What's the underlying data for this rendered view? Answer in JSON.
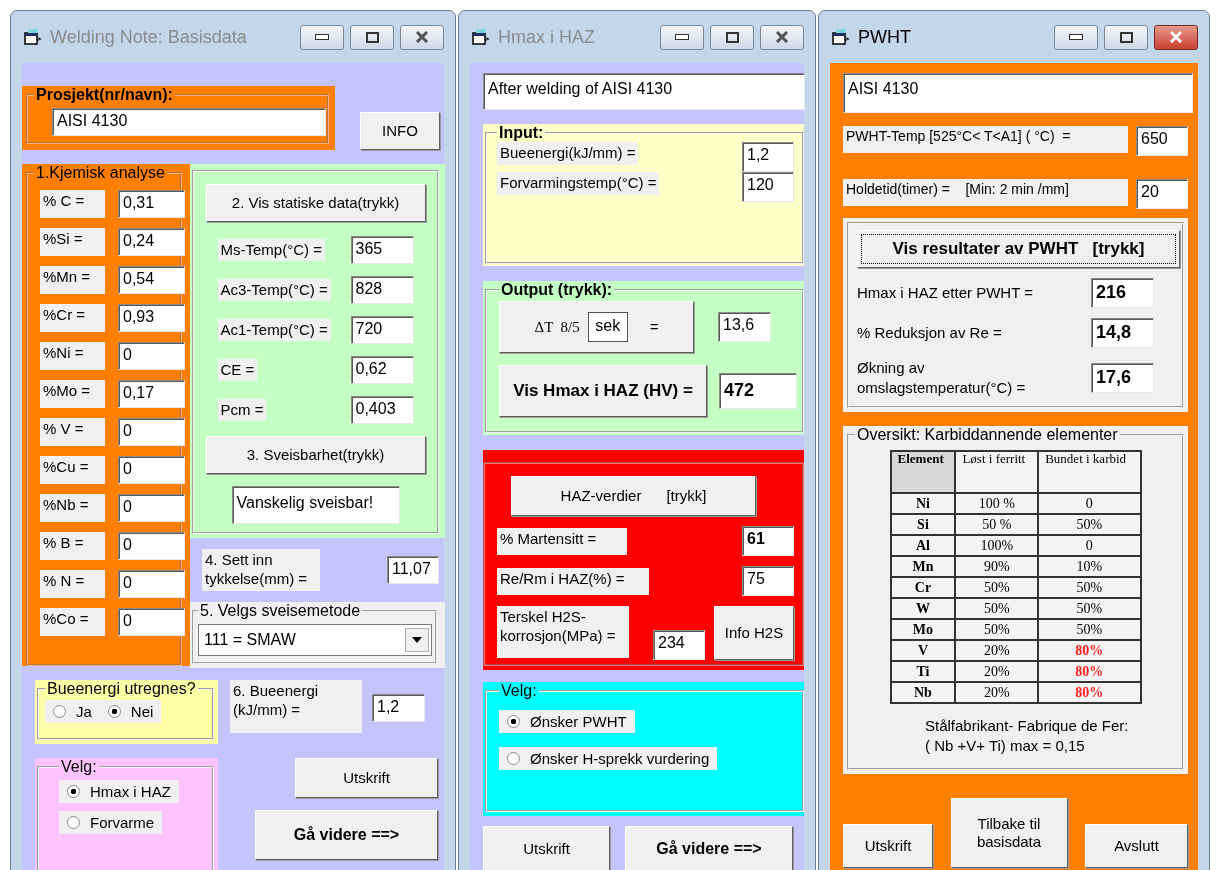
{
  "basisdata": {
    "title": "Welding Note: Basisdata",
    "active": false,
    "project": {
      "legend": "Prosjekt(nr/navn):",
      "value": "AISI 4130"
    },
    "info_button": "INFO",
    "chemistry": {
      "legend": "1.Kjemisk analyse",
      "rows": [
        {
          "label": "% C =",
          "value": "0,31"
        },
        {
          "label": "%Si =",
          "value": "0,24"
        },
        {
          "label": "%Mn =",
          "value": "0,54"
        },
        {
          "label": "%Cr =",
          "value": "0,93"
        },
        {
          "label": "%Ni =",
          "value": "0"
        },
        {
          "label": "%Mo =",
          "value": "0,17"
        },
        {
          "label": "% V =",
          "value": "0"
        },
        {
          "label": "%Cu =",
          "value": "0"
        },
        {
          "label": "%Nb =",
          "value": "0"
        },
        {
          "label": "% B =",
          "value": "0"
        },
        {
          "label": "% N =",
          "value": "0"
        },
        {
          "label": "%Co =",
          "value": "0"
        }
      ]
    },
    "static": {
      "button": "2. Vis statiske data(trykk)",
      "rows": [
        {
          "label": "Ms-Temp(°C) =",
          "value": "365"
        },
        {
          "label": "Ac3-Temp(°C) =",
          "value": "828"
        },
        {
          "label": "Ac1-Temp(°C) =",
          "value": "720"
        },
        {
          "label": "CE =",
          "value": "0,62"
        },
        {
          "label": "Pcm =",
          "value": "0,403"
        }
      ],
      "weld_button": "3. Sveisbarhet(trykk)",
      "verdict": "Vanskelig sveisbar!"
    },
    "thickness": {
      "label": "4. Sett inn tykkelse(mm) =",
      "value": "11,07"
    },
    "method": {
      "legend": "5. Velgs sveisemetode",
      "value": "111 = SMAW"
    },
    "arc_calc": {
      "legend": "Bueenergi utregnes?",
      "options": [
        {
          "label": "Ja",
          "selected": false
        },
        {
          "label": "Nei",
          "selected": true
        }
      ]
    },
    "arc_energy": {
      "label": "6. Bueenergi (kJ/mm) =",
      "value": "1,2"
    },
    "choice": {
      "legend": "Velg:",
      "options": [
        {
          "label": "Hmax i HAZ",
          "selected": true
        },
        {
          "label": "Forvarme",
          "selected": false
        }
      ]
    },
    "print_button": "Utskrift",
    "next_button": "Gå videre ==>"
  },
  "hmax": {
    "title": "Hmax i HAZ",
    "active": false,
    "heading": "After welding of AISI 4130",
    "input": {
      "legend": "Input:",
      "rows": [
        {
          "label": "Bueenergi(kJ/mm) =",
          "value": "1,2"
        },
        {
          "label": "Forvarmingstemp(°C) =",
          "value": "120"
        }
      ]
    },
    "output": {
      "legend": "Output (trykk):",
      "delta_button": {
        "symbol": "ΔT  8/5",
        "unit": "sek",
        "equals": "="
      },
      "delta_value": "13,6",
      "hmax_button": "Vis Hmax i HAZ (HV) =",
      "hmax_value": "472"
    },
    "haz": {
      "button": "HAZ-verdier      [trykk]",
      "rows": [
        {
          "label": "% Martensitt =",
          "value": "61"
        },
        {
          "label": "Re/Rm i HAZ(%) =",
          "value": "75"
        },
        {
          "label": "Terskel H2S-korrosjon(MPa) =",
          "value": "234"
        }
      ],
      "info_button": "Info H2S"
    },
    "choice": {
      "legend": "Velg:",
      "options": [
        {
          "label": "Ønsker PWHT",
          "selected": true
        },
        {
          "label": "Ønsker H-sprekk vurdering",
          "selected": false
        }
      ]
    },
    "print_button": "Utskrift",
    "next_button": "Gå videre ==>"
  },
  "pwht": {
    "title": "PWHT",
    "active": true,
    "heading": "AISI 4130",
    "settings": [
      {
        "label": "PWHT-Temp [525°C< T<A1] ( °C)  =",
        "value": "650"
      },
      {
        "label": "Holdetid(timer) =    [Min: 2 min /mm]",
        "value": "20"
      }
    ],
    "results_button": "Vis resultater av PWHT   [trykk]",
    "results": [
      {
        "label": "Hmax i HAZ etter PWHT =",
        "value": "216"
      },
      {
        "label": "% Reduksjon av Re =",
        "value": "14,8"
      },
      {
        "label": "Økning av omslagstemperatur(°C) =",
        "value": "17,6"
      }
    ],
    "overview": {
      "legend": "Oversikt: Karbiddannende elementer",
      "columns": [
        "Element",
        "Løst i ferritt",
        "Bundet i karbid"
      ],
      "rows": [
        {
          "element": "Ni",
          "ferritt": "100 %",
          "karbid": "0",
          "warning": false
        },
        {
          "element": "Si",
          "ferritt": "50 %",
          "karbid": "50%",
          "warning": false
        },
        {
          "element": "Al",
          "ferritt": "100%",
          "karbid": "0",
          "warning": false
        },
        {
          "element": "Mn",
          "ferritt": "90%",
          "karbid": "10%",
          "warning": false
        },
        {
          "element": "Cr",
          "ferritt": "50%",
          "karbid": "50%",
          "warning": false
        },
        {
          "element": "W",
          "ferritt": "50%",
          "karbid": "50%",
          "warning": false
        },
        {
          "element": "Mo",
          "ferritt": "50%",
          "karbid": "50%",
          "warning": false
        },
        {
          "element": "V",
          "ferritt": "20%",
          "karbid": "80%",
          "warning": true
        },
        {
          "element": "Ti",
          "ferritt": "20%",
          "karbid": "80%",
          "warning": true
        },
        {
          "element": "Nb",
          "ferritt": "20%",
          "karbid": "80%",
          "warning": true
        }
      ],
      "note": [
        "Stålfabrikant- Fabrique de Fer:",
        "( Nb +V+ Ti) max = 0,15"
      ]
    },
    "print_button": "Utskrift",
    "back_button": "Tilbake til basisdata",
    "exit_button": "Avslutt"
  }
}
